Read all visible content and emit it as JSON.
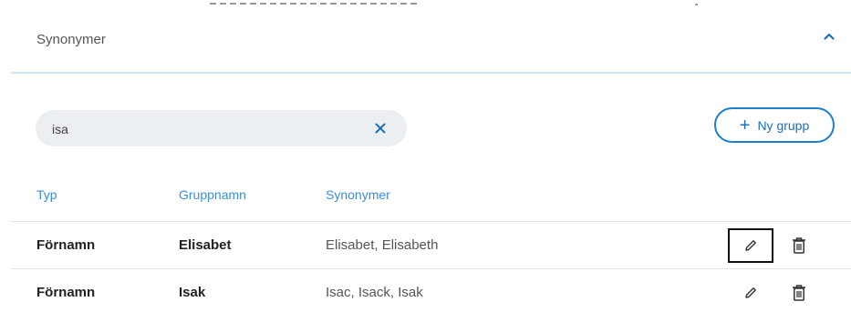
{
  "section": {
    "title": "Synonymer",
    "collapse_icon": "chevron-up-icon"
  },
  "search": {
    "value": "isa",
    "clear_icon": "close-icon"
  },
  "actions": {
    "new_group_label": "Ny grupp",
    "new_group_icon": "plus-icon"
  },
  "table": {
    "headers": {
      "type": "Typ",
      "group": "Gruppnamn",
      "synonyms": "Synonymer"
    },
    "rows": [
      {
        "type": "Förnamn",
        "group": "Elisabet",
        "synonyms": "Elisabet, Elisabeth",
        "edit_focused": true
      },
      {
        "type": "Förnamn",
        "group": "Isak",
        "synonyms": "Isac, Isack, Isak",
        "edit_focused": false
      }
    ],
    "row_icons": {
      "edit": "pencil-icon",
      "delete": "trash-icon"
    }
  },
  "colors": {
    "accent": "#1b7fd0",
    "header_text": "#3b8ed6",
    "search_bg": "#eceff1"
  }
}
